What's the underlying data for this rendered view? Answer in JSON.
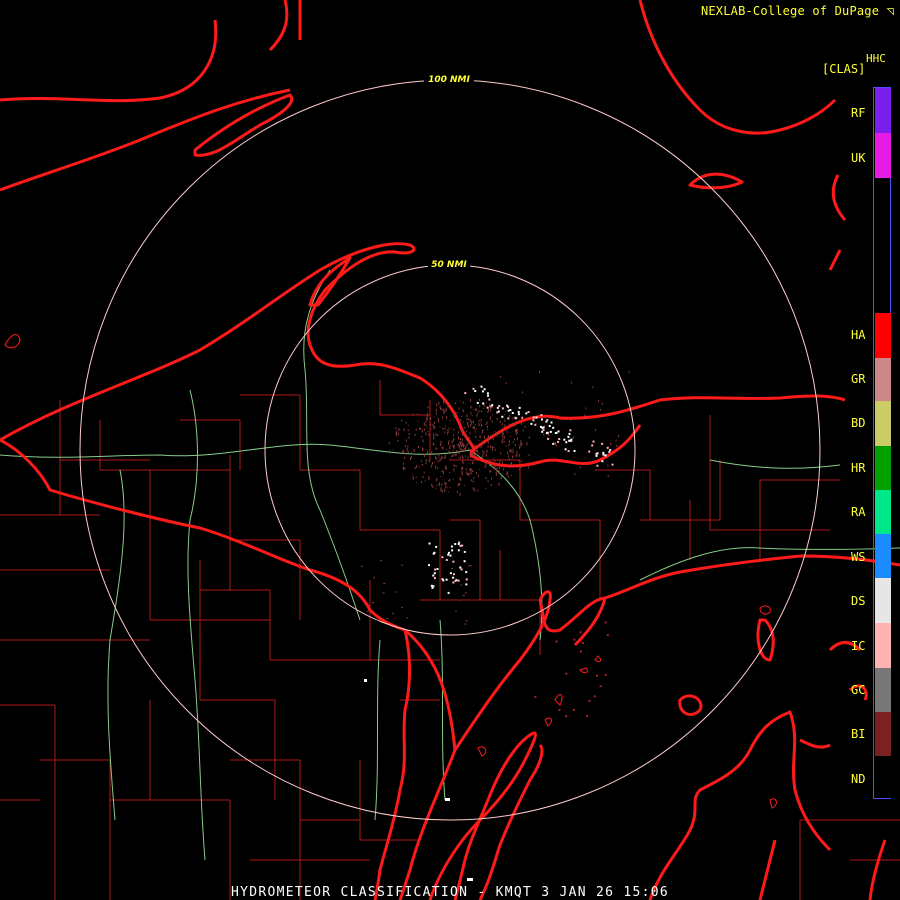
{
  "header": {
    "credit": "NEXLAB-College of DuPage ◹"
  },
  "legend": {
    "product": "HHC",
    "unit": "[CLAS]",
    "classes": [
      {
        "code": "RF",
        "color": "#7a1ff0"
      },
      {
        "code": "UK",
        "color": "#e61be6"
      },
      {
        "code": "HA",
        "color": "#ff0000"
      },
      {
        "code": "GR",
        "color": "#cc8888"
      },
      {
        "code": "BD",
        "color": "#cccc66"
      },
      {
        "code": "HR",
        "color": "#00a000"
      },
      {
        "code": "RA",
        "color": "#00e68a"
      },
      {
        "code": "WS",
        "color": "#1a8cff"
      },
      {
        "code": "DS",
        "color": "#e6e6e6"
      },
      {
        "code": "IC",
        "color": "#ffb3b3"
      },
      {
        "code": "GC",
        "color": "#777777"
      },
      {
        "code": "BI",
        "color": "#7a2222"
      },
      {
        "code": "ND",
        "color": "#000000"
      }
    ]
  },
  "rings": [
    {
      "label": "100 NMI"
    },
    {
      "label": "50 NMI"
    }
  ],
  "colors": {
    "coast": "#ff1a1a",
    "county": "#b01818",
    "state": "#ff1a1a",
    "river": "#88cc88",
    "ring": "#ffcccc"
  },
  "footer": {
    "title": "HYDROMETEOR CLASSIFICATION - KMQT 3 JAN 26 15:06"
  }
}
